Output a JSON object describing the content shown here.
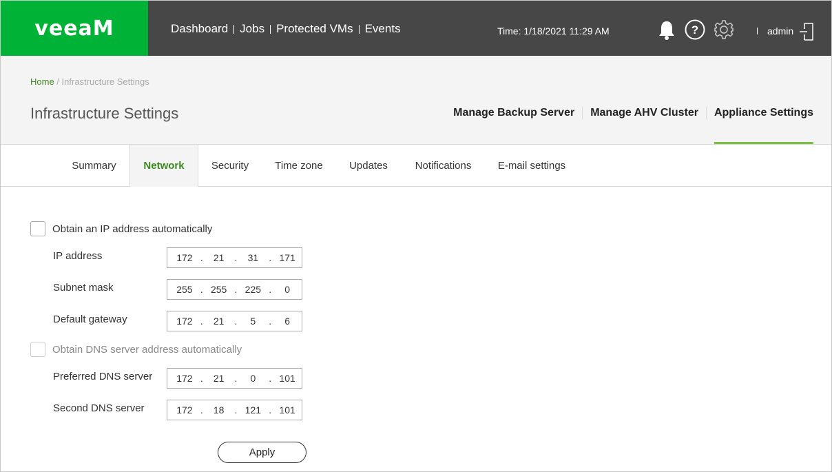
{
  "brand": {
    "logo_text": "veeaM",
    "color": "#00b336"
  },
  "topnav": {
    "items": [
      "Dashboard",
      "Jobs",
      "Protected VMs",
      "Events"
    ],
    "time_label": "Time: 1/18/2021 11:29 AM",
    "user": "admin",
    "icons": [
      "bell-icon",
      "help-icon",
      "gear-icon",
      "logout-icon"
    ]
  },
  "breadcrumb": {
    "home": "Home",
    "separator": " / ",
    "current": "Infrastructure Settings"
  },
  "page_title": "Infrastructure Settings",
  "manage_tabs": [
    "Manage Backup Server",
    "Manage AHV Cluster",
    "Appliance Settings"
  ],
  "subtabs": [
    "Summary",
    "Network",
    "Security",
    "Time zone",
    "Updates",
    "Notifications",
    "E-mail settings"
  ],
  "form": {
    "obtain_ip_auto": {
      "label": "Obtain an IP address automatically",
      "checked": false
    },
    "ip_address": {
      "label": "IP address",
      "octets": [
        "172",
        "21",
        "31",
        "171"
      ]
    },
    "subnet_mask": {
      "label": "Subnet mask",
      "octets": [
        "255",
        "255",
        "225",
        "0"
      ]
    },
    "default_gateway": {
      "label": "Default gateway",
      "octets": [
        "172",
        "21",
        "5",
        "6"
      ]
    },
    "obtain_dns_auto": {
      "label": "Obtain DNS server address automatically",
      "checked": false
    },
    "preferred_dns": {
      "label": "Preferred DNS server",
      "octets": [
        "172",
        "21",
        "0",
        "101"
      ]
    },
    "second_dns": {
      "label": "Second DNS server",
      "octets": [
        "172",
        "18",
        "121",
        "101"
      ]
    },
    "apply_label": "Apply"
  }
}
